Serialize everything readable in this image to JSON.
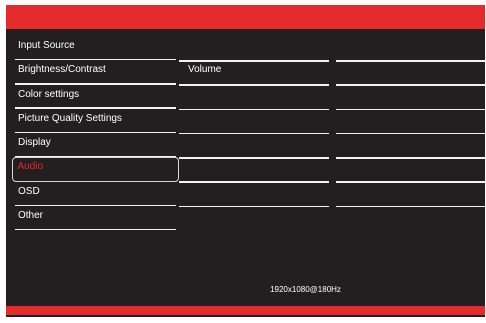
{
  "colors": {
    "accent": "#e52b2b",
    "background": "#231f20",
    "text": "#ffffff",
    "selected_text": "#e52b2b"
  },
  "menu": {
    "items": [
      {
        "label": "Input Source"
      },
      {
        "label": "Brightness/Contrast"
      },
      {
        "label": "Color settings"
      },
      {
        "label": "Picture Quality Settings"
      },
      {
        "label": "Display"
      },
      {
        "label": "Audio",
        "selected": true
      },
      {
        "label": "OSD"
      },
      {
        "label": "Other"
      }
    ]
  },
  "submenu": {
    "rows": [
      {
        "label": "Volume"
      },
      {
        "label": ""
      },
      {
        "label": ""
      },
      {
        "label": ""
      },
      {
        "label": ""
      },
      {
        "label": ""
      },
      {
        "label": ""
      }
    ]
  },
  "status": {
    "resolution": "1920x1080@180Hz"
  }
}
